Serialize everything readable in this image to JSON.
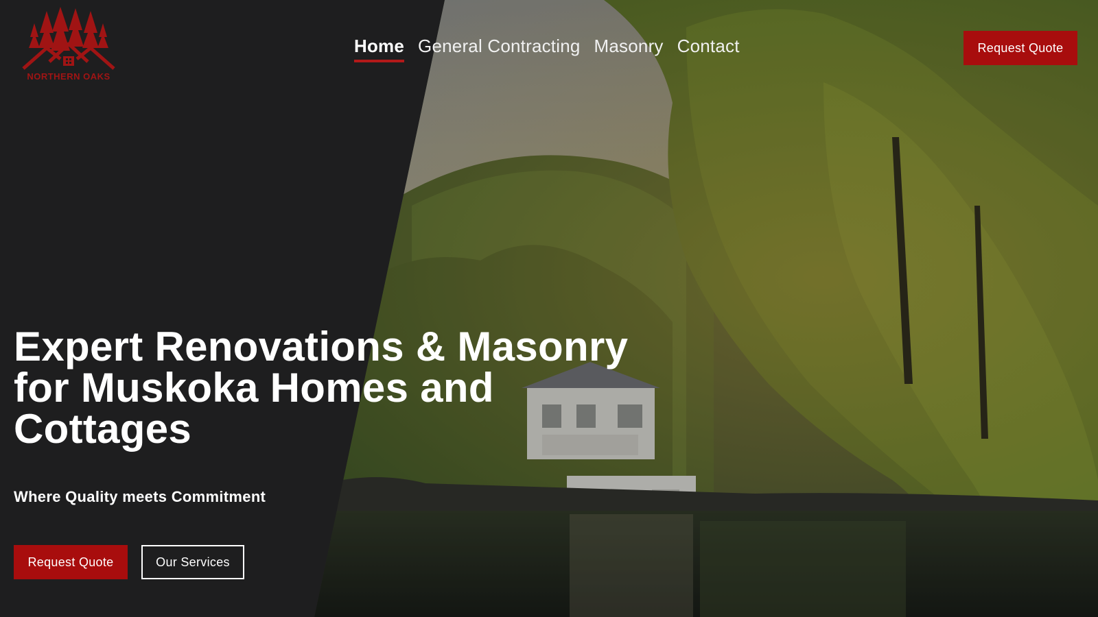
{
  "brand": {
    "logo_text": "NORTHERN OAKS",
    "logo_color": "#a01414"
  },
  "nav": {
    "items": [
      {
        "label": "Home",
        "active": true
      },
      {
        "label": "General Contracting",
        "active": false
      },
      {
        "label": "Masonry",
        "active": false
      },
      {
        "label": "Contact",
        "active": false
      }
    ]
  },
  "header": {
    "cta_label": "Request Quote"
  },
  "hero": {
    "title": "Expert Renovations & Masonry for Muskoka Homes and Cottages",
    "subtitle": "Where Quality meets Commitment",
    "primary_cta": "Request Quote",
    "secondary_cta": "Our Services"
  },
  "colors": {
    "accent": "#a80d0d",
    "panel": "#1e1e1f",
    "text": "#ffffff"
  },
  "icons": [
    "pine-tree-house-logo-icon"
  ]
}
